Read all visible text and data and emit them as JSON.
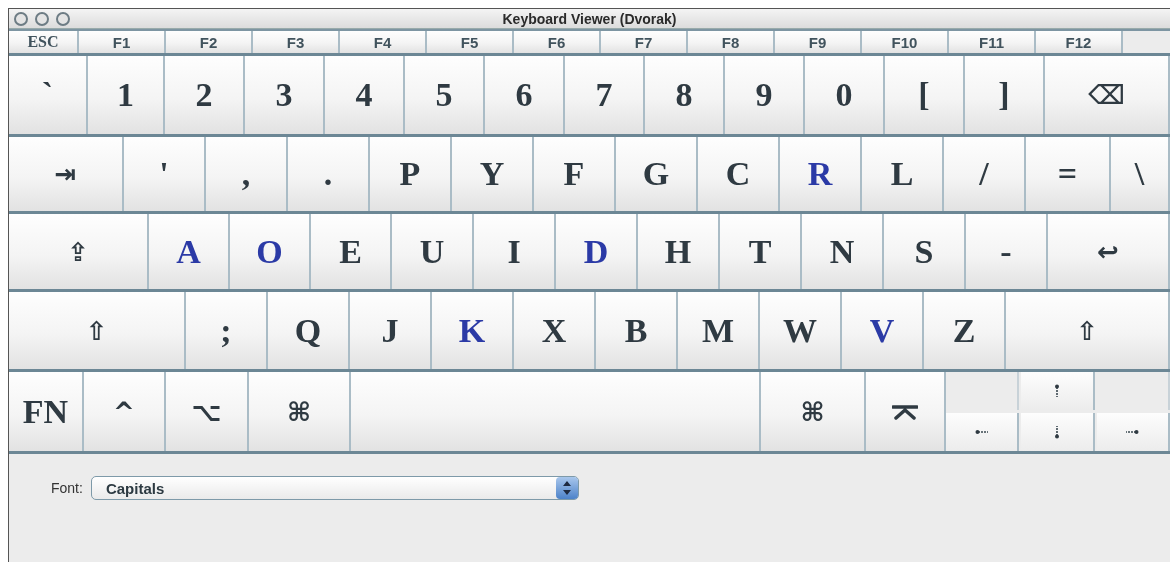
{
  "window": {
    "title": "Keyboard Viewer (Dvorak)"
  },
  "function_keys": [
    "ESC",
    "F1",
    "F2",
    "F3",
    "F4",
    "F5",
    "F6",
    "F7",
    "F8",
    "F9",
    "F10",
    "F11",
    "F12"
  ],
  "rows": [
    [
      {
        "kind": "char",
        "label": "`",
        "color": "#2f3a42"
      },
      {
        "kind": "char",
        "label": "1",
        "color": "#2f3a42"
      },
      {
        "kind": "char",
        "label": "2",
        "color": "#2f3a42"
      },
      {
        "kind": "char",
        "label": "3",
        "color": "#2f3a42"
      },
      {
        "kind": "char",
        "label": "4",
        "color": "#2f3a42"
      },
      {
        "kind": "char",
        "label": "5",
        "color": "#2f3a42"
      },
      {
        "kind": "char",
        "label": "6",
        "color": "#2f3a42"
      },
      {
        "kind": "char",
        "label": "7",
        "color": "#2f3a42"
      },
      {
        "kind": "char",
        "label": "8",
        "color": "#2f3a42"
      },
      {
        "kind": "char",
        "label": "9",
        "color": "#2f3a42"
      },
      {
        "kind": "char",
        "label": "0",
        "color": "#2f3a42"
      },
      {
        "kind": "char",
        "label": "[",
        "color": "#2f3a42"
      },
      {
        "kind": "char",
        "label": "]",
        "color": "#2f3a42"
      },
      {
        "kind": "symbol",
        "label": "⌫",
        "color": "#2f3a42"
      }
    ],
    [
      {
        "kind": "symbol",
        "label": "⇥",
        "color": "#2f3a42"
      },
      {
        "kind": "char",
        "label": "'",
        "color": "#2f3a42"
      },
      {
        "kind": "char",
        "label": ",",
        "color": "#2f3a42"
      },
      {
        "kind": "char",
        "label": ".",
        "color": "#2f3a42"
      },
      {
        "kind": "char",
        "label": "P",
        "color": "#2f3a42"
      },
      {
        "kind": "char",
        "label": "Y",
        "color": "#2f3a42"
      },
      {
        "kind": "char",
        "label": "F",
        "color": "#2f3a42"
      },
      {
        "kind": "char",
        "label": "G",
        "color": "#2f3a42"
      },
      {
        "kind": "char",
        "label": "C",
        "color": "#2f3a42"
      },
      {
        "kind": "char",
        "label": "R",
        "color": "#2b3aa6"
      },
      {
        "kind": "char",
        "label": "L",
        "color": "#2f3a42"
      },
      {
        "kind": "char",
        "label": "/",
        "color": "#2f3a42"
      },
      {
        "kind": "char",
        "label": "=",
        "color": "#2f3a42"
      },
      {
        "kind": "char",
        "label": "\\",
        "color": "#2f3a42"
      }
    ],
    [
      {
        "kind": "symbol",
        "label": "⇪",
        "color": "#2f3a42"
      },
      {
        "kind": "char",
        "label": "A",
        "color": "#2b3aa6"
      },
      {
        "kind": "char",
        "label": "O",
        "color": "#2b3aa6"
      },
      {
        "kind": "char",
        "label": "E",
        "color": "#2f3a42"
      },
      {
        "kind": "char",
        "label": "U",
        "color": "#2f3a42"
      },
      {
        "kind": "char",
        "label": "I",
        "color": "#2f3a42"
      },
      {
        "kind": "char",
        "label": "D",
        "color": "#2b3aa6"
      },
      {
        "kind": "char",
        "label": "H",
        "color": "#2f3a42"
      },
      {
        "kind": "char",
        "label": "T",
        "color": "#2f3a42"
      },
      {
        "kind": "char",
        "label": "N",
        "color": "#2f3a42"
      },
      {
        "kind": "char",
        "label": "S",
        "color": "#2f3a42"
      },
      {
        "kind": "char",
        "label": "-",
        "color": "#2f3a42"
      },
      {
        "kind": "symbol",
        "label": "↩",
        "color": "#2f3a42"
      }
    ],
    [
      {
        "kind": "symbol",
        "label": "⇧",
        "color": "#2f3a42"
      },
      {
        "kind": "char",
        "label": ";",
        "color": "#2f3a42"
      },
      {
        "kind": "char",
        "label": "Q",
        "color": "#2f3a42"
      },
      {
        "kind": "char",
        "label": "J",
        "color": "#2f3a42"
      },
      {
        "kind": "char",
        "label": "K",
        "color": "#2b3aa6"
      },
      {
        "kind": "char",
        "label": "X",
        "color": "#2f3a42"
      },
      {
        "kind": "char",
        "label": "B",
        "color": "#2f3a42"
      },
      {
        "kind": "char",
        "label": "M",
        "color": "#2f3a42"
      },
      {
        "kind": "char",
        "label": "W",
        "color": "#2f3a42"
      },
      {
        "kind": "char",
        "label": "V",
        "color": "#2b3aa6"
      },
      {
        "kind": "char",
        "label": "Z",
        "color": "#2f3a42"
      },
      {
        "kind": "symbol",
        "label": "⇧",
        "color": "#2f3a42"
      }
    ],
    [
      {
        "kind": "char",
        "label": "FN",
        "color": "#2f3a42"
      },
      {
        "kind": "symbol",
        "label": "^",
        "color": "#2f3a42"
      },
      {
        "kind": "symbol",
        "label": "⌥",
        "color": "#2f3a42"
      },
      {
        "kind": "symbol",
        "label": "⌘",
        "color": "#2f3a42"
      },
      {
        "kind": "space"
      },
      {
        "kind": "symbol",
        "label": "⌘",
        "color": "#2f3a42"
      },
      {
        "kind": "eject"
      },
      {
        "kind": "arrows"
      }
    ]
  ],
  "font_selector": {
    "label": "Font:",
    "value": "Capitals"
  }
}
